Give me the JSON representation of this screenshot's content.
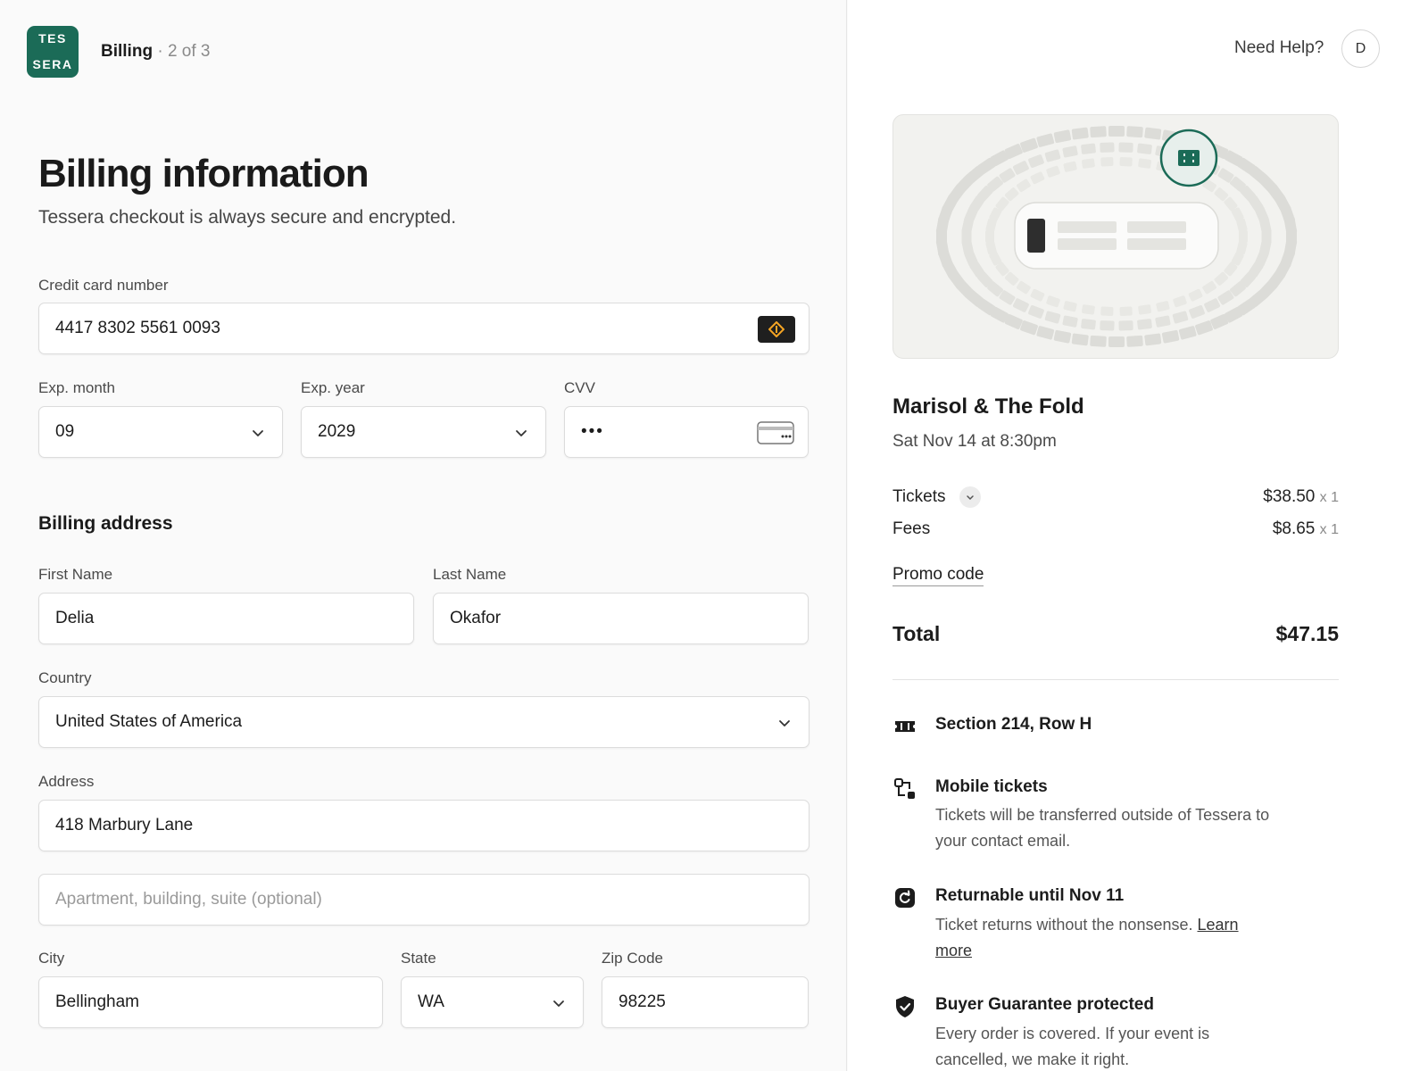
{
  "brand": {
    "logo_line1": "TES",
    "logo_line2": "SERA",
    "color": "#1b6b57"
  },
  "breadcrumb": {
    "step": "Billing",
    "separator": " · ",
    "count": "2 of 3"
  },
  "page": {
    "title": "Billing information",
    "subtitle": "Tessera checkout is always secure and encrypted."
  },
  "payment": {
    "card_label": "Credit card number",
    "card_value": "4417 8302 5561 0093",
    "exp_month_label": "Exp. month",
    "exp_month_value": "09",
    "exp_year_label": "Exp. year",
    "exp_year_value": "2029",
    "cvv_label": "CVV",
    "cvv_value": "•••"
  },
  "address": {
    "heading": "Billing address",
    "first_name_label": "First Name",
    "first_name_value": "Delia",
    "last_name_label": "Last Name",
    "last_name_value": "Okafor",
    "country_label": "Country",
    "country_value": "United States of America",
    "address_label": "Address",
    "address_value": "418 Marbury Lane",
    "address2_placeholder": "Apartment, building, suite (optional)",
    "city_label": "City",
    "city_value": "Bellingham",
    "state_label": "State",
    "state_value": "WA",
    "zip_label": "Zip Code",
    "zip_value": "98225"
  },
  "header_right": {
    "help": "Need Help?",
    "avatar_initial": "D"
  },
  "event": {
    "title": "Marisol & The Fold",
    "date": "Sat Nov 14 at 8:30pm"
  },
  "summary": {
    "tickets_label": "Tickets",
    "tickets_price": "$38.50",
    "tickets_qty": "x 1",
    "fees_label": "Fees",
    "fees_price": "$8.65",
    "fees_qty": "x 1",
    "promo_label": "Promo code",
    "total_label": "Total",
    "total_value": "$47.15"
  },
  "perks": [
    {
      "icon": "ticket-icon",
      "title": "Section 214, Row H",
      "desc": ""
    },
    {
      "icon": "transfer-icon",
      "title": "Mobile tickets",
      "desc": "Tickets will be transferred outside of Tessera to your contact email."
    },
    {
      "icon": "refresh-icon",
      "title": "Returnable until Nov 11",
      "desc": "Ticket returns without the nonsense.",
      "link": "Learn more"
    },
    {
      "icon": "shield-check-icon",
      "title": "Buyer Guarantee protected",
      "desc": "Every order is covered. If your event is cancelled, we make it right."
    }
  ]
}
